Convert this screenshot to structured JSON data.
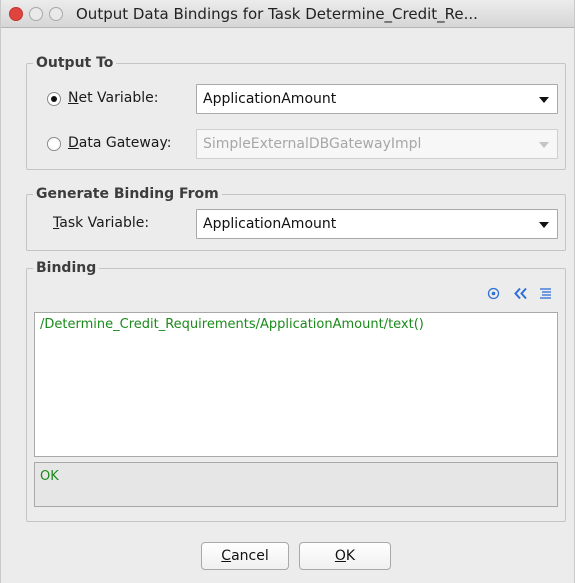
{
  "window": {
    "title": "Output Data Bindings for Task Determine_Credit_Re..."
  },
  "output_to": {
    "legend": "Output To",
    "net_variable": {
      "label_mnemonic": "N",
      "label_rest": "et Variable:",
      "selected": true,
      "value": "ApplicationAmount"
    },
    "data_gateway": {
      "label_mnemonic": "D",
      "label_rest": "ata Gateway:",
      "selected": false,
      "value": "SimpleExternalDBGatewayImpl",
      "disabled": true
    }
  },
  "generate_binding": {
    "legend": "Generate Binding From",
    "task_variable": {
      "label_mnemonic": "T",
      "label_rest": "ask Variable:",
      "value": "ApplicationAmount"
    }
  },
  "binding": {
    "legend": "Binding",
    "toolbar": {
      "target_icon": "target-icon",
      "collapse_icon": "double-chevron-left-icon",
      "format_icon": "align-lines-icon"
    },
    "expression": "/Determine_Credit_Requirements/ApplicationAmount/text()",
    "status": "OK"
  },
  "buttons": {
    "cancel_mnemonic": "C",
    "cancel_rest": "ancel",
    "ok_mnemonic": "O",
    "ok_rest": "K"
  },
  "colors": {
    "accent_green": "#1b8a1b",
    "close_red": "#e0443e",
    "toolbar_blue": "#2e6fd8"
  }
}
